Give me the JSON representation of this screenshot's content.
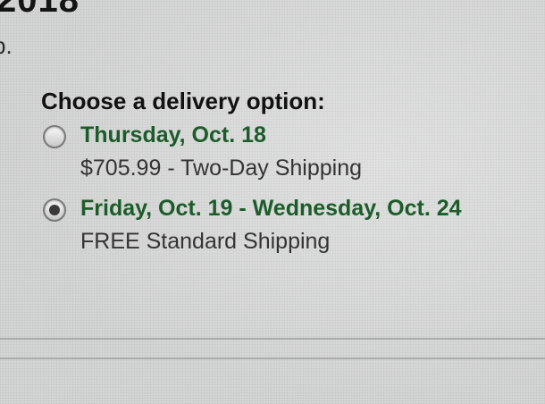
{
  "top_fragment": {
    "year_text": "2018",
    "note_text": "p."
  },
  "delivery": {
    "heading": "Choose a delivery option:",
    "options": [
      {
        "date": "Thursday, Oct. 18",
        "detail": "$705.99 - Two-Day Shipping",
        "selected": false
      },
      {
        "date": "Friday, Oct. 19 - Wednesday, Oct. 24",
        "detail": "FREE Standard Shipping",
        "selected": true
      }
    ]
  },
  "colors": {
    "date_green": "#1d5c2a",
    "text": "#333333",
    "background": "#d4d6d5"
  }
}
